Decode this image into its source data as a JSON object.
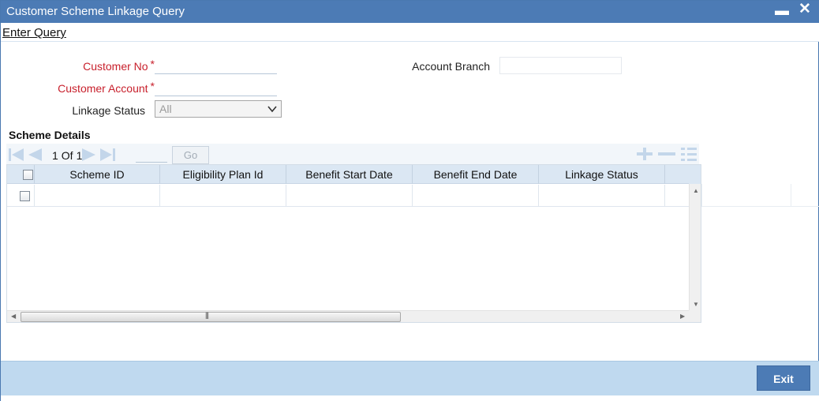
{
  "window": {
    "title": "Customer Scheme Linkage Query",
    "minimize_glyph": "▬",
    "close_glyph": "✕"
  },
  "menu": {
    "enter_query": "Enter Query"
  },
  "form": {
    "customer_no_label": "Customer No",
    "customer_no_value": "",
    "customer_account_label": "Customer Account",
    "customer_account_value": "",
    "linkage_status_label": "Linkage Status",
    "linkage_status_value": "All",
    "account_branch_label": "Account Branch",
    "account_branch_value": "",
    "required_marker": "*"
  },
  "scheme_details": {
    "title": "Scheme Details",
    "pagination": {
      "current_page": "1",
      "of_label": "Of",
      "total_pages": "1",
      "go_label": "Go"
    },
    "columns": [
      "Scheme ID",
      "Eligibility Plan Id",
      "Benefit Start Date",
      "Benefit End Date",
      "Linkage Status"
    ],
    "rows": [
      {
        "scheme_id": "",
        "eligibility_plan_id": "",
        "benefit_start_date": "",
        "benefit_end_date": "",
        "linkage_status": ""
      }
    ],
    "hscroll_grip": "|||"
  },
  "footer": {
    "exit_label": "Exit"
  },
  "colors": {
    "titlebar": "#4c7bb5",
    "required_label": "#c8202c",
    "grid_header": "#dbe7f3",
    "footer": "#bfd9ef",
    "exit_button": "#4c7bb5"
  }
}
